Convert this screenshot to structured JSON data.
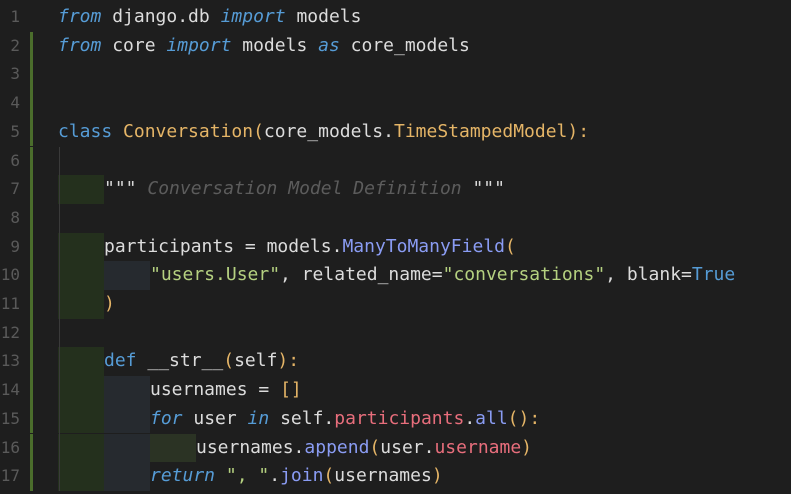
{
  "editor": {
    "line_numbers": [
      "1",
      "2",
      "3",
      "4",
      "5",
      "6",
      "7",
      "8",
      "9",
      "10",
      "11",
      "12",
      "13",
      "14",
      "15",
      "16",
      "17"
    ],
    "lines": [
      [
        {
          "t": "from",
          "c": "k-it"
        },
        {
          "t": " django.db ",
          "c": "id"
        },
        {
          "t": "import",
          "c": "k-it"
        },
        {
          "t": " models",
          "c": "id"
        }
      ],
      [
        {
          "t": "from",
          "c": "k-it"
        },
        {
          "t": " core ",
          "c": "id"
        },
        {
          "t": "import",
          "c": "k-it"
        },
        {
          "t": " models ",
          "c": "id"
        },
        {
          "t": "as",
          "c": "k-it"
        },
        {
          "t": " core_models",
          "c": "id"
        }
      ],
      [],
      [],
      [
        {
          "t": "class",
          "c": "k"
        },
        {
          "t": " Conversation",
          "c": "cls"
        },
        {
          "t": "(",
          "c": "punc"
        },
        {
          "t": "core_models",
          "c": "id"
        },
        {
          "t": ".",
          "c": "id"
        },
        {
          "t": "TimeStampedModel",
          "c": "cls2"
        },
        {
          "t": "):",
          "c": "punc"
        }
      ],
      [],
      [
        {
          "t": "\"\"\"",
          "c": "pl"
        },
        {
          "t": " Conversation Model Definition ",
          "c": "cmt"
        },
        {
          "t": "\"\"\"",
          "c": "pl"
        }
      ],
      [],
      [
        {
          "t": "participants",
          "c": "id"
        },
        {
          "t": " = ",
          "c": "id"
        },
        {
          "t": "models",
          "c": "id"
        },
        {
          "t": ".",
          "c": "id"
        },
        {
          "t": "ManyToManyField",
          "c": "fn"
        },
        {
          "t": "(",
          "c": "punc"
        }
      ],
      [
        {
          "t": "\"users.User\"",
          "c": "str"
        },
        {
          "t": ", related_name=",
          "c": "id"
        },
        {
          "t": "\"conversations\"",
          "c": "str"
        },
        {
          "t": ", blank=",
          "c": "id"
        },
        {
          "t": "True",
          "c": "const"
        }
      ],
      [
        {
          "t": ")",
          "c": "punc"
        }
      ],
      [],
      [
        {
          "t": "def",
          "c": "k"
        },
        {
          "t": " __str__",
          "c": "id"
        },
        {
          "t": "(",
          "c": "punc"
        },
        {
          "t": "self",
          "c": "id"
        },
        {
          "t": "):",
          "c": "punc"
        }
      ],
      [
        {
          "t": "usernames",
          "c": "id"
        },
        {
          "t": " = ",
          "c": "id"
        },
        {
          "t": "[]",
          "c": "punc"
        }
      ],
      [
        {
          "t": "for",
          "c": "k-it"
        },
        {
          "t": " user ",
          "c": "id"
        },
        {
          "t": "in",
          "c": "k-it"
        },
        {
          "t": " self.",
          "c": "id"
        },
        {
          "t": "participants",
          "c": "attr"
        },
        {
          "t": ".",
          "c": "id"
        },
        {
          "t": "all",
          "c": "fn"
        },
        {
          "t": "():",
          "c": "punc"
        }
      ],
      [
        {
          "t": "usernames",
          "c": "id"
        },
        {
          "t": ".",
          "c": "id"
        },
        {
          "t": "append",
          "c": "fn"
        },
        {
          "t": "(",
          "c": "punc"
        },
        {
          "t": "user",
          "c": "id"
        },
        {
          "t": ".",
          "c": "id"
        },
        {
          "t": "username",
          "c": "attr"
        },
        {
          "t": ")",
          "c": "punc"
        }
      ],
      [
        {
          "t": "return",
          "c": "k-it"
        },
        {
          "t": " \", \"",
          "c": "str"
        },
        {
          "t": ".",
          "c": "id"
        },
        {
          "t": "join",
          "c": "fn"
        },
        {
          "t": "(",
          "c": "punc"
        },
        {
          "t": "usernames",
          "c": "id"
        },
        {
          "t": ")",
          "c": "punc"
        }
      ]
    ],
    "indent_levels": [
      0,
      0,
      0,
      0,
      0,
      0,
      1,
      0,
      1,
      2,
      1,
      0,
      1,
      2,
      2,
      3,
      2
    ],
    "git_modified_lines": [
      2,
      3,
      4,
      5,
      6,
      7,
      8,
      9,
      10,
      11,
      12,
      13,
      14,
      15,
      16,
      17
    ],
    "colors": {
      "background": "#1e1e1e",
      "keyword": "#569cd6",
      "class_name": "#e5b567",
      "string": "#b5d180",
      "comment": "#5c5c5c",
      "function": "#8a9cf3",
      "attribute": "#e86e7c",
      "git_added_bar": "#4b6d2c"
    }
  }
}
